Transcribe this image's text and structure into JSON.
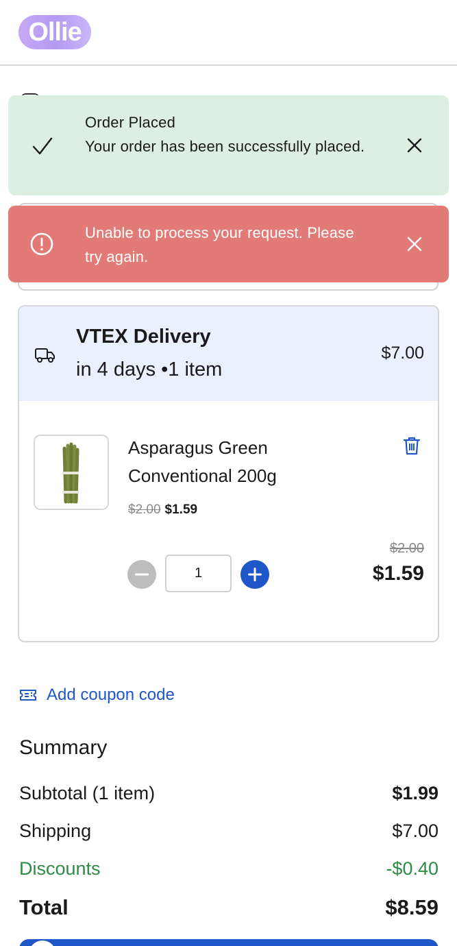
{
  "header": {
    "logo_text": "Ollie"
  },
  "toasts": {
    "success": {
      "title": "Order Placed",
      "message": "Your order has been successfully placed.",
      "icon": "check-icon",
      "close_icon": "close-icon",
      "bg_color": "#dcefe2"
    },
    "error": {
      "message": "Unable to process your request. Please try again.",
      "icon": "alert-circle-icon",
      "close_icon": "close-icon",
      "bg_color": "#e27b78"
    }
  },
  "delivery": {
    "icon": "truck-icon",
    "title": "VTEX Delivery",
    "subtitle": "in 4 days •1 item",
    "price": "$7.00",
    "bg_color": "#e8f1fd"
  },
  "item": {
    "name": "Asparagus Green Conventional 200g",
    "list_price": "$2.00",
    "sale_price": "$1.59",
    "quantity": "1",
    "line_list_price": "$2.00",
    "line_total": "$1.59",
    "delete_icon": "trash-icon"
  },
  "coupon": {
    "label": "Add coupon code",
    "icon": "coupon-icon"
  },
  "summary": {
    "title": "Summary",
    "subtotal_label": "Subtotal (1 item)",
    "subtotal_value": "$1.99",
    "shipping_label": "Shipping",
    "shipping_value": "$7.00",
    "discounts_label": "Discounts",
    "discounts_value": "-$0.40",
    "total_label": "Total",
    "total_value": "$8.59"
  },
  "colors": {
    "accent": "#1f56c8",
    "discount": "#2e8b45"
  }
}
